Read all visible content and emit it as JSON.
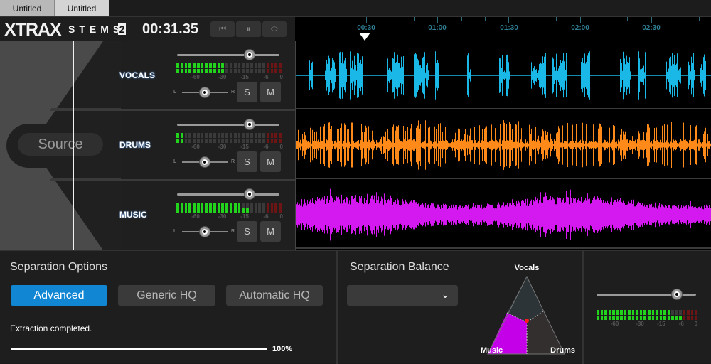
{
  "tabs": [
    {
      "label": "Untitled",
      "active": false
    },
    {
      "label": "Untitled",
      "active": true
    }
  ],
  "header": {
    "logo_main": "XTRAX",
    "logo_sub": "STEMS",
    "logo_version": "2",
    "timecode": "00:31.35",
    "transport": [
      {
        "name": "rewind",
        "glyph": "⏮"
      },
      {
        "name": "pause",
        "glyph": "⏸"
      },
      {
        "name": "loop",
        "glyph": "⬭"
      }
    ]
  },
  "timeline": {
    "labels": [
      "00:30",
      "01:00",
      "01:30",
      "02:00",
      "02:30"
    ],
    "playhead_time": "00:31.35"
  },
  "source": {
    "label": "Source"
  },
  "meter_scale": [
    "-60",
    "-30",
    "-15",
    "-6",
    "0"
  ],
  "meter_segments": 26,
  "stems": [
    {
      "name": "VOCALS",
      "color": "#1ab8e6",
      "volume": 0.71,
      "pan": 0.5,
      "meter_lit": [
        12,
        12
      ],
      "solo_label": "S",
      "mute_label": "M",
      "pan_left": "L",
      "pan_right": "R"
    },
    {
      "name": "DRUMS",
      "color": "#ff8a1a",
      "volume": 0.71,
      "pan": 0.5,
      "meter_lit": [
        2,
        2
      ],
      "solo_label": "S",
      "mute_label": "M",
      "pan_left": "L",
      "pan_right": "R"
    },
    {
      "name": "MUSIC",
      "color": "#d418f0",
      "volume": 0.71,
      "pan": 0.5,
      "meter_lit": [
        16,
        18
      ],
      "solo_label": "S",
      "mute_label": "M",
      "pan_left": "L",
      "pan_right": "R"
    }
  ],
  "separation_options": {
    "title": "Separation Options",
    "buttons": [
      {
        "label": "Advanced",
        "active": true
      },
      {
        "label": "Generic HQ",
        "active": false
      },
      {
        "label": "Automatic HQ",
        "active": false
      }
    ],
    "status": "Extraction completed.",
    "progress": 100,
    "progress_label": "100%"
  },
  "separation_balance": {
    "title": "Separation Balance",
    "preset_value": "",
    "labels": {
      "top": "Vocals",
      "left": "Music",
      "right": "Drums"
    },
    "colors": {
      "music": "#c400e8",
      "vocals": "#2d3437",
      "drums": "#322f2e",
      "point": "#ff1a1a"
    }
  },
  "master": {
    "volume": 0.81,
    "meter_lit": [
      19,
      22
    ]
  },
  "colors": {
    "accent": "#1187d4",
    "meter_green": "#22d41c",
    "meter_red": "#6d1515",
    "timeline_text": "#2f7f93"
  }
}
